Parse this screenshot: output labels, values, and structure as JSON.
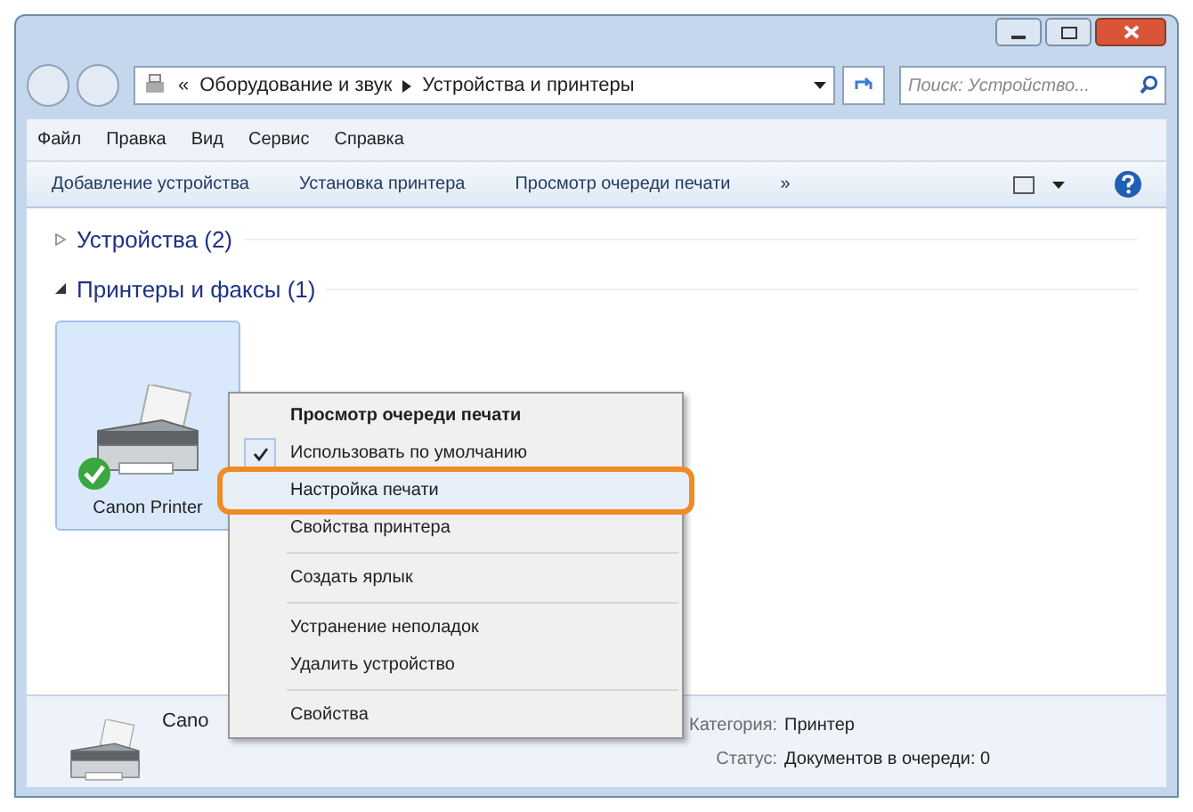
{
  "window": {
    "controls": [
      {
        "kind": "minimize"
      },
      {
        "kind": "maximize"
      },
      {
        "kind": "close"
      }
    ]
  },
  "address_bar": {
    "prefix": "«",
    "path": [
      "Оборудование и звук",
      "Устройства и принтеры"
    ]
  },
  "search": {
    "placeholder": "Поиск: Устройство..."
  },
  "menu_bar": [
    "Файл",
    "Правка",
    "Вид",
    "Сервис",
    "Справка"
  ],
  "toolbar": {
    "buttons": [
      "Добавление устройства",
      "Установка принтера",
      "Просмотр очереди печати"
    ],
    "more": "»"
  },
  "groups": [
    {
      "label": "Устройства (2)",
      "expanded": false
    },
    {
      "label": "Принтеры и факсы (1)",
      "expanded": true
    }
  ],
  "device": {
    "name": "Canon Printer",
    "selected": true,
    "default": true
  },
  "context_menu": [
    {
      "kind": "item",
      "label": "Просмотр очереди печати",
      "bold": true,
      "checked": false,
      "highlighted": false
    },
    {
      "kind": "item",
      "label": "Использовать по умолчанию",
      "bold": false,
      "checked": true,
      "highlighted": false
    },
    {
      "kind": "item",
      "label": "Настройка печати",
      "bold": false,
      "checked": false,
      "highlighted": true
    },
    {
      "kind": "item",
      "label": "Свойства принтера",
      "bold": false,
      "checked": false,
      "highlighted": false
    },
    {
      "kind": "separator"
    },
    {
      "kind": "item",
      "label": "Создать ярлык",
      "bold": false,
      "checked": false,
      "highlighted": false
    },
    {
      "kind": "separator"
    },
    {
      "kind": "item",
      "label": "Устранение неполадок",
      "bold": false,
      "checked": false,
      "highlighted": false
    },
    {
      "kind": "item",
      "label": "Удалить устройство",
      "bold": false,
      "checked": false,
      "highlighted": false
    },
    {
      "kind": "separator"
    },
    {
      "kind": "item",
      "label": "Свойства",
      "bold": false,
      "checked": false,
      "highlighted": false
    }
  ],
  "details": {
    "name": "Cano",
    "fields": [
      {
        "label": "Категория:",
        "value": "Принтер"
      },
      {
        "label": "Статус:",
        "value": "Документов в очереди: 0"
      }
    ]
  }
}
